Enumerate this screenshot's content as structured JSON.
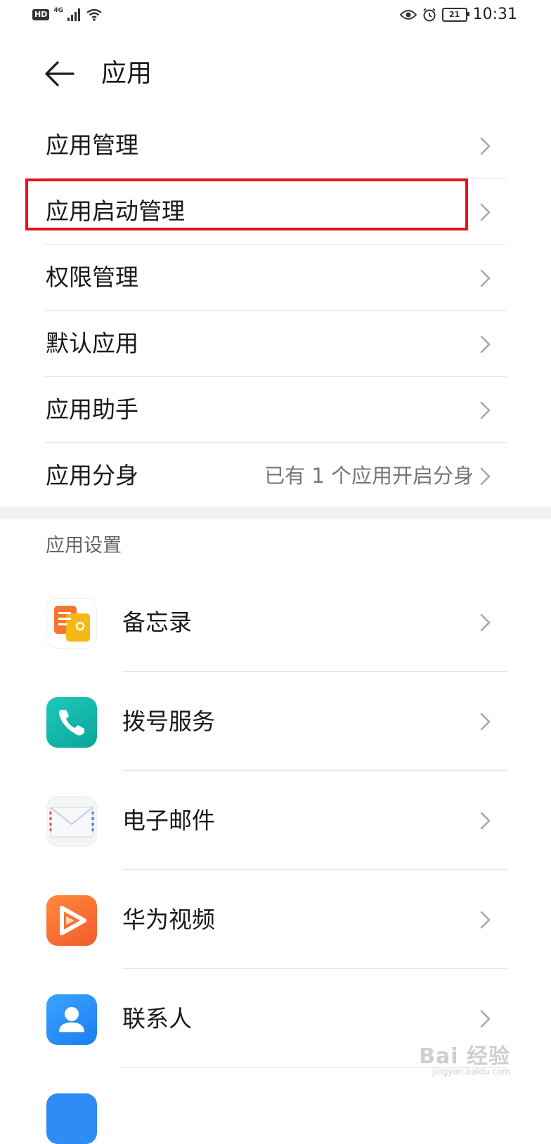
{
  "status_bar": {
    "hd": "HD",
    "network": "4G",
    "time": "10:31",
    "battery": "21"
  },
  "header": {
    "title": "应用"
  },
  "menu": [
    {
      "label": "应用管理",
      "value": ""
    },
    {
      "label": "应用启动管理",
      "value": "",
      "highlighted": true
    },
    {
      "label": "权限管理",
      "value": ""
    },
    {
      "label": "默认应用",
      "value": ""
    },
    {
      "label": "应用助手",
      "value": ""
    },
    {
      "label": "应用分身",
      "value": "已有 1 个应用开启分身"
    }
  ],
  "app_settings": {
    "title": "应用设置",
    "apps": [
      {
        "label": "备忘录",
        "icon": "notepad-icon"
      },
      {
        "label": "拨号服务",
        "icon": "phone-icon"
      },
      {
        "label": "电子邮件",
        "icon": "mail-icon"
      },
      {
        "label": "华为视频",
        "icon": "video-icon"
      },
      {
        "label": "联系人",
        "icon": "contacts-icon"
      }
    ]
  },
  "watermark": {
    "text": "Bai 经验",
    "sub": "jingyan.baidu.com"
  },
  "colors": {
    "highlight": "#e8141b",
    "divider": "#e3e3e3",
    "secondary_text": "#777777"
  }
}
